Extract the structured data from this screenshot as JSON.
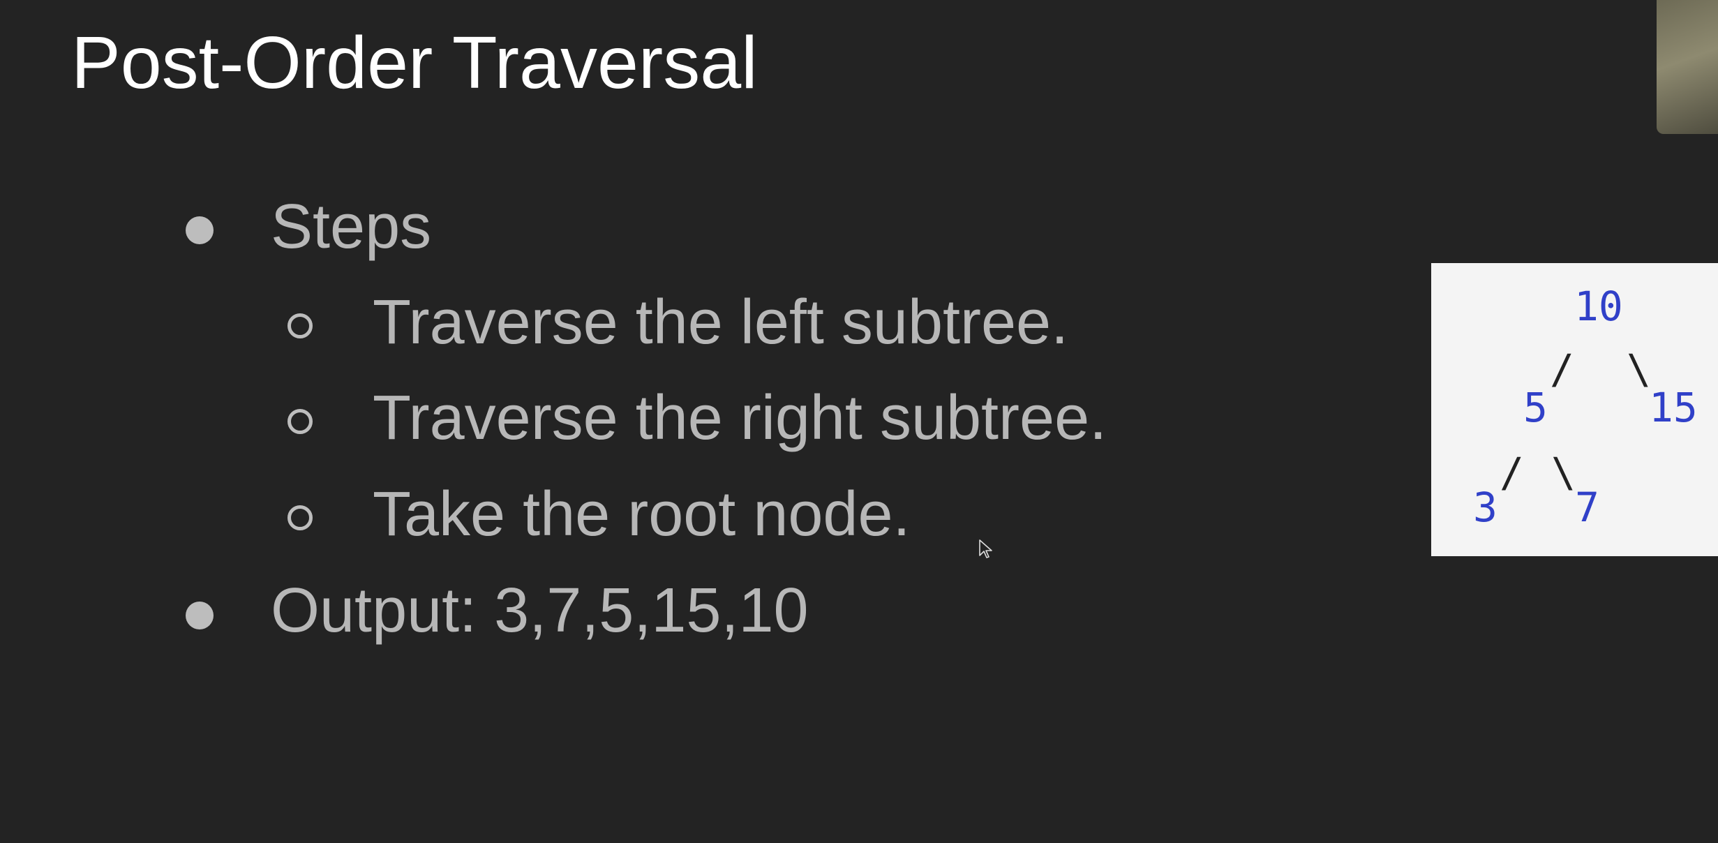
{
  "slide": {
    "title": "Post-Order Traversal",
    "bullets": [
      {
        "text": "Steps",
        "sub": [
          "Traverse the left subtree.",
          "Traverse the right subtree.",
          "Take the root node."
        ]
      },
      {
        "text": "Output: 3,7,5,15,10"
      }
    ]
  },
  "tree": {
    "root": "10",
    "left": "5",
    "right": "15",
    "left_left": "3",
    "left_right": "7"
  },
  "icons": [
    "bullet-dot-icon",
    "bullet-ring-icon",
    "mouse-cursor-icon"
  ],
  "colors": {
    "background": "#232323",
    "title": "#ffffff",
    "body_text": "#b7b7b7",
    "tree_panel": "#f4f4f4",
    "tree_node": "#3040c8"
  }
}
